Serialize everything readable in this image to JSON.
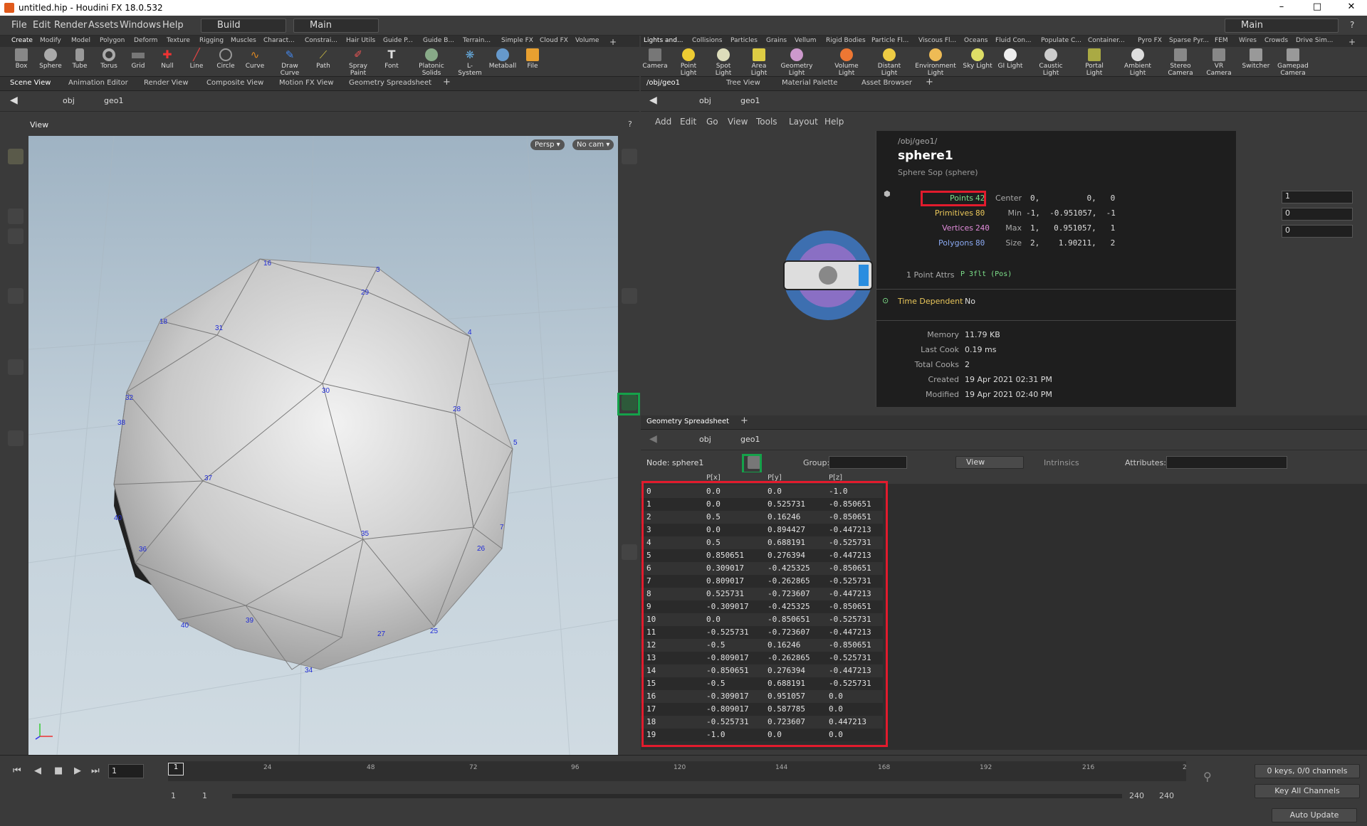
{
  "window": {
    "title": "untitled.hip - Houdini FX 18.0.532",
    "minimize": "–",
    "maximize": "□",
    "close": "✕"
  },
  "menu": {
    "items": [
      "File",
      "Edit",
      "Render",
      "Assets",
      "Windows",
      "Help"
    ],
    "desktop_left": "Build",
    "desktop_mid": "Main",
    "desktop_right": "Main"
  },
  "shelf_left": {
    "tabs": [
      "Create",
      "Modify",
      "Model",
      "Polygon",
      "Deform",
      "Texture",
      "Rigging",
      "Muscles",
      "Charact...",
      "Constrai...",
      "Hair Utils",
      "Guide P...",
      "Guide B...",
      "Terrain...",
      "Simple FX",
      "Cloud FX",
      "Volume"
    ],
    "tools": [
      "Box",
      "Sphere",
      "Tube",
      "Torus",
      "Grid",
      "Null",
      "Line",
      "Circle",
      "Curve",
      "Draw Curve",
      "Path",
      "Spray Paint",
      "Font",
      "Platonic Solids",
      "L-System",
      "Metaball",
      "File"
    ]
  },
  "shelf_right": {
    "tabs": [
      "Lights and...",
      "Collisions",
      "Particles",
      "Grains",
      "Vellum",
      "Rigid Bodies",
      "Particle Fl...",
      "Viscous Fl...",
      "Oceans",
      "Fluid Con...",
      "Populate C...",
      "Container...",
      "Pyro FX",
      "Sparse Pyr...",
      "FEM",
      "Wires",
      "Crowds",
      "Drive Sim..."
    ],
    "tools": [
      "Camera",
      "Point Light",
      "Spot Light",
      "Area Light",
      "Geometry Light",
      "Volume Light",
      "Distant Light",
      "Environment Light",
      "Sky Light",
      "GI Light",
      "Caustic Light",
      "Portal Light",
      "Ambient Light",
      "Stereo Camera",
      "VR Camera",
      "Switcher",
      "Gamepad Camera"
    ]
  },
  "left_pane": {
    "tabs": [
      "Scene View",
      "Animation Editor",
      "Render View",
      "Composite View",
      "Motion FX View",
      "Geometry Spreadsheet"
    ],
    "path": [
      "obj",
      "geo1"
    ],
    "view_label": "View",
    "persp": "Persp ▾",
    "cam": "No cam ▾",
    "point_labels": [
      "16",
      "3",
      "29",
      "18",
      "31",
      "4",
      "32",
      "30",
      "28",
      "38",
      "5",
      "37",
      "40",
      "35",
      "7",
      "36",
      "26",
      "39",
      "40",
      "27",
      "25",
      "34"
    ]
  },
  "right_top": {
    "tabs": [
      "/obj/geo1",
      "Tree View",
      "Material Palette",
      "Asset Browser"
    ],
    "path": [
      "obj",
      "geo1"
    ],
    "menu": [
      "Add",
      "Edit",
      "Go",
      "View",
      "Tools",
      "Layout",
      "Help"
    ]
  },
  "info": {
    "path": "/obj/geo1/",
    "node_name": "sphere1",
    "node_type": "Sphere Sop (sphere)",
    "points_label": "Points",
    "points": "42",
    "prims_label": "Primitives",
    "prims": "80",
    "verts_label": "Vertices",
    "verts": "240",
    "polys_label": "Polygons",
    "polys": "80",
    "center_label": "Center",
    "center": "0,          0,   0",
    "min_label": "Min",
    "min": "-1,  -0.951057,  -1",
    "max_label": "Max",
    "max": "1,   0.951057,   1",
    "size_label": "Size",
    "size": "2,    1.90211,   2",
    "attrs_label": "1 Point Attrs",
    "attrs": "P 3flt (Pos)",
    "time_dep_label": "Time Dependent",
    "time_dep": "No",
    "memory_label": "Memory",
    "memory": "11.79 KB",
    "last_cook_label": "Last Cook",
    "last_cook": "0.19 ms",
    "total_cooks_label": "Total Cooks",
    "total_cooks": "2",
    "created_label": "Created",
    "created": "19 Apr 2021 02:31 PM",
    "modified_label": "Modified",
    "modified": "19 Apr 2021 02:40 PM"
  },
  "param_values": [
    "1",
    "0",
    "0"
  ],
  "sheet": {
    "tab": "Geometry Spreadsheet",
    "path": [
      "obj",
      "geo1"
    ],
    "node_label": "Node: sphere1",
    "group_label": "Group:",
    "view_label": "View",
    "intrinsics_label": "Intrinsics",
    "attributes_label": "Attributes:",
    "columns": [
      "",
      "P[x]",
      "P[y]",
      "P[z]"
    ],
    "rows": [
      [
        "0",
        "0.0",
        "0.0",
        "-1.0"
      ],
      [
        "1",
        "0.0",
        "0.525731",
        "-0.850651"
      ],
      [
        "2",
        "0.5",
        "0.16246",
        "-0.850651"
      ],
      [
        "3",
        "0.0",
        "0.894427",
        "-0.447213"
      ],
      [
        "4",
        "0.5",
        "0.688191",
        "-0.525731"
      ],
      [
        "5",
        "0.850651",
        "0.276394",
        "-0.447213"
      ],
      [
        "6",
        "0.309017",
        "-0.425325",
        "-0.850651"
      ],
      [
        "7",
        "0.809017",
        "-0.262865",
        "-0.525731"
      ],
      [
        "8",
        "0.525731",
        "-0.723607",
        "-0.447213"
      ],
      [
        "9",
        "-0.309017",
        "-0.425325",
        "-0.850651"
      ],
      [
        "10",
        "0.0",
        "-0.850651",
        "-0.525731"
      ],
      [
        "11",
        "-0.525731",
        "-0.723607",
        "-0.447213"
      ],
      [
        "12",
        "-0.5",
        "0.16246",
        "-0.850651"
      ],
      [
        "13",
        "-0.809017",
        "-0.262865",
        "-0.525731"
      ],
      [
        "14",
        "-0.850651",
        "0.276394",
        "-0.447213"
      ],
      [
        "15",
        "-0.5",
        "0.688191",
        "-0.525731"
      ],
      [
        "16",
        "-0.309017",
        "0.951057",
        "0.0"
      ],
      [
        "17",
        "-0.809017",
        "0.587785",
        "0.0"
      ],
      [
        "18",
        "-0.525731",
        "0.723607",
        "0.447213"
      ],
      [
        "19",
        "-1.0",
        "0.0",
        "0.0"
      ]
    ]
  },
  "timeline": {
    "frame": "1",
    "ticks": [
      "24",
      "48",
      "72",
      "96",
      "120",
      "144",
      "168",
      "192",
      "216",
      "2"
    ],
    "current_marker": "1",
    "range_start": "1",
    "range_start2": "1",
    "range_end": "240",
    "range_end2": "240",
    "keys": "0 keys, 0/0 channels",
    "key_all": "Key All Channels",
    "auto_update": "Auto Update"
  }
}
